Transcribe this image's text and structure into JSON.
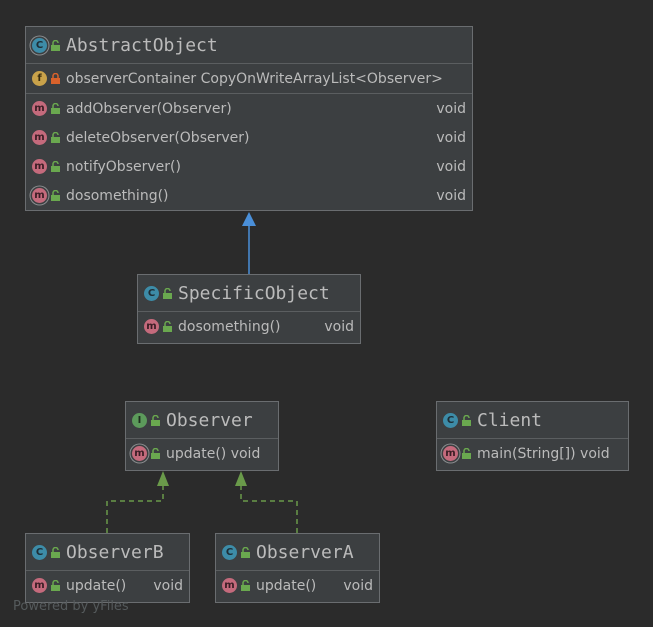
{
  "classes": {
    "abstract_object": {
      "name": "AbstractObject",
      "field": {
        "label": "observerContainer CopyOnWriteArrayList<Observer>"
      },
      "methods": [
        {
          "label": "addObserver(Observer)",
          "ret": "void"
        },
        {
          "label": "deleteObserver(Observer)",
          "ret": "void"
        },
        {
          "label": "notifyObserver()",
          "ret": "void"
        },
        {
          "label": "dosomething()",
          "ret": "void"
        }
      ]
    },
    "specific_object": {
      "name": "SpecificObject",
      "methods": [
        {
          "label": "dosomething()",
          "ret": "void"
        }
      ]
    },
    "observer": {
      "name": "Observer",
      "methods": [
        {
          "label": "update() void"
        }
      ]
    },
    "client": {
      "name": "Client",
      "methods": [
        {
          "label": "main(String[]) void"
        }
      ]
    },
    "observer_b": {
      "name": "ObserverB",
      "methods": [
        {
          "label": "update()",
          "ret": "void"
        }
      ]
    },
    "observer_a": {
      "name": "ObserverA",
      "methods": [
        {
          "label": "update()",
          "ret": "void"
        }
      ]
    }
  },
  "icons": {
    "class": "C",
    "interface": "I",
    "method": "m",
    "field": "f"
  },
  "colors": {
    "inheritance_arrow": "#4a8fd9",
    "implementation_arrow": "#6a9a4a"
  },
  "footer": {
    "text": "Powered by yFiles"
  }
}
